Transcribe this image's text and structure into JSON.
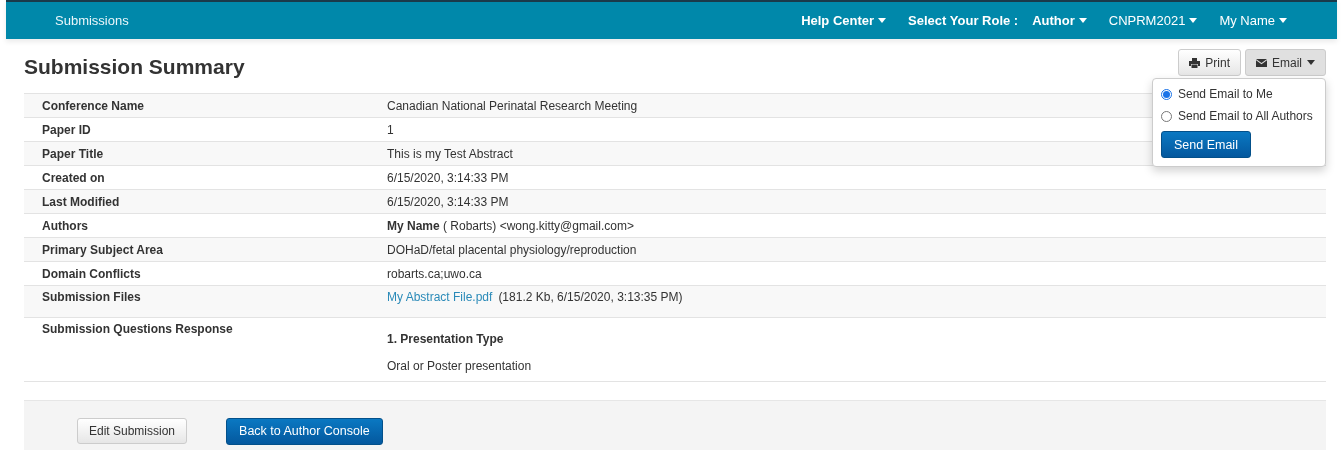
{
  "navbar": {
    "brand": "Submissions",
    "menus": [
      {
        "label": "Help Center",
        "kind": "menu"
      },
      {
        "label": "Select Your Role :",
        "kind": "label"
      },
      {
        "label": "Author",
        "kind": "menu"
      },
      {
        "label": "CNPRM2021",
        "kind": "menu"
      },
      {
        "label": "My Name",
        "kind": "menu"
      }
    ]
  },
  "page_title": "Submission Summary",
  "actions": {
    "print": "Print",
    "email": "Email",
    "email_menu": {
      "options": [
        {
          "label": "Send Email to Me",
          "selected": true
        },
        {
          "label": "Send Email to All Authors",
          "selected": false
        }
      ],
      "button": "Send Email"
    }
  },
  "rows": [
    {
      "kind": "text",
      "label": "Conference Name",
      "value": "Canadian National Perinatal Research Meeting"
    },
    {
      "kind": "text",
      "label": "Paper ID",
      "value": "1"
    },
    {
      "kind": "text",
      "label": "Paper Title",
      "value": "This is my Test Abstract"
    },
    {
      "kind": "text",
      "label": "Created on",
      "value": "6/15/2020, 3:14:33 PM"
    },
    {
      "kind": "text",
      "label": "Last Modified",
      "value": "6/15/2020, 3:14:33 PM"
    },
    {
      "kind": "text",
      "label": "Authors",
      "value": "**My Name** ( Robarts) <wong.kitty@gmail.com>"
    },
    {
      "kind": "text",
      "label": "Primary Subject Area",
      "value": "DOHaD/fetal placental physiology/reproduction"
    },
    {
      "kind": "text",
      "label": "Domain Conflicts",
      "value": "robarts.ca;uwo.ca"
    },
    {
      "kind": "file",
      "label": "Submission Files",
      "link": "My Abstract File.pdf",
      "detail": "(181.2 Kb, 6/15/2020, 3:13:35 PM)"
    },
    {
      "kind": "questions",
      "label": "Submission Questions Response",
      "question": "1. Presentation Type",
      "answer": "Oral or Poster presentation"
    }
  ],
  "footer_buttons": [
    {
      "label": "Edit Submission",
      "kind": "default"
    },
    {
      "label": "Back to Author Console",
      "kind": "primary"
    }
  ]
}
